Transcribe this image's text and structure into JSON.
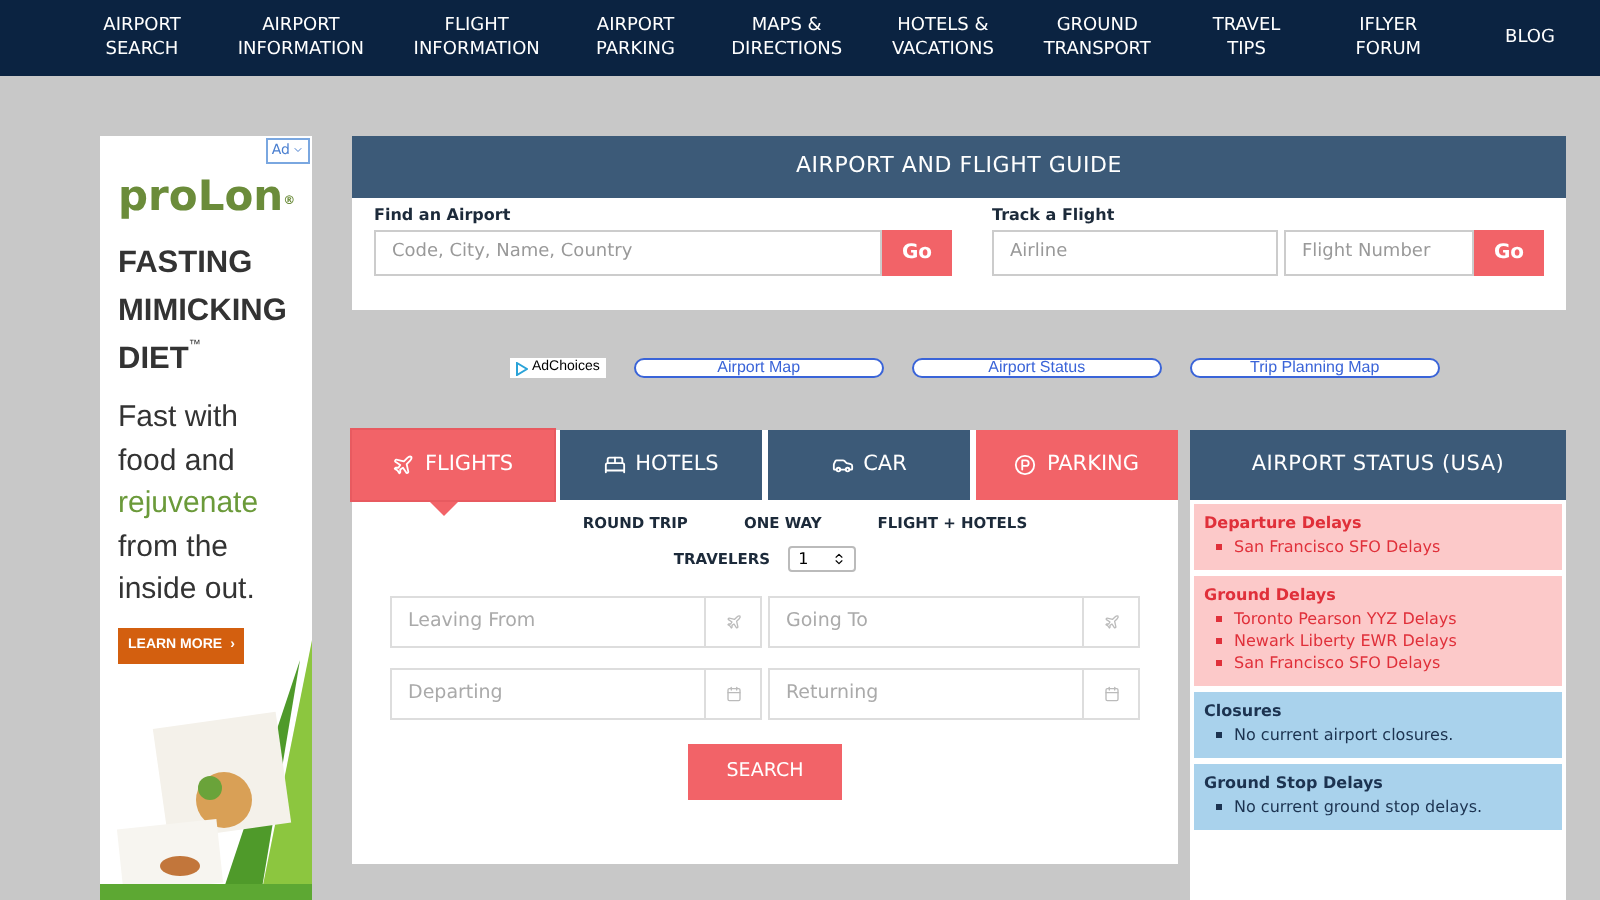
{
  "nav": [
    "AIRPORT SEARCH",
    "AIRPORT INFORMATION",
    "FLIGHT INFORMATION",
    "AIRPORT PARKING",
    "MAPS & DIRECTIONS",
    "HOTELS & VACATIONS",
    "GROUND TRANSPORT",
    "TRAVEL TIPS",
    "IFLYER FORUM",
    "BLOG"
  ],
  "ad": {
    "badge": "Ad",
    "brand": "proLon",
    "trademark": "®",
    "headline": [
      "FASTING",
      "MIMICKING",
      "DIET"
    ],
    "headline_mark": "™",
    "body_lines": [
      {
        "text": "Fast with",
        "highlighted": false
      },
      {
        "text": "food and",
        "highlighted": false
      },
      {
        "text": "rejuvenate",
        "highlighted": true
      },
      {
        "text": "from the",
        "highlighted": false
      },
      {
        "text": "inside out.",
        "highlighted": false
      }
    ],
    "button": "LEARN MORE",
    "button_icon": "›",
    "picture": {
      "kind": "picture"
    }
  },
  "guide": {
    "title": "AIRPORT AND FLIGHT GUIDE",
    "find": {
      "label": "Find an Airport",
      "placeholder": "Code, City, Name, Country",
      "button": "Go"
    },
    "track": {
      "label": "Track a Flight",
      "airline_placeholder": "Airline",
      "flight_placeholder": "Flight Number",
      "button": "Go"
    }
  },
  "links": {
    "adchoices": "AdChoices",
    "items": [
      "Airport Map",
      "Airport Status",
      "Trip Planning Map"
    ]
  },
  "booking": {
    "tabs": [
      {
        "label": "FLIGHTS",
        "color": "#f26368",
        "selected": true
      },
      {
        "label": "HOTELS",
        "color": "#3c5a78",
        "selected": false
      },
      {
        "label": "CAR",
        "color": "#3c5a78",
        "selected": false
      },
      {
        "label": "PARKING",
        "color": "#f26368",
        "selected": false
      }
    ],
    "trip_types": [
      "ROUND TRIP",
      "ONE WAY",
      "FLIGHT + HOTELS"
    ],
    "travelers": {
      "label": "TRAVELERS",
      "value": "1"
    },
    "fields": [
      {
        "placeholder": "Leaving From",
        "kind": "place"
      },
      {
        "placeholder": "Going To",
        "kind": "place"
      },
      {
        "placeholder": "Departing",
        "kind": "date"
      },
      {
        "placeholder": "Returning",
        "kind": "date"
      }
    ],
    "search": "SEARCH"
  },
  "status": {
    "title": "AIRPORT STATUS (USA)",
    "sections": [
      {
        "kind": "alert",
        "heading": "Departure Delays",
        "items": [
          "San Francisco SFO Delays"
        ]
      },
      {
        "kind": "alert",
        "heading": "Ground Delays",
        "items": [
          "Toronto Pearson YYZ Delays",
          "Newark Liberty EWR Delays",
          "San Francisco SFO Delays"
        ]
      },
      {
        "kind": "info",
        "heading": "Closures",
        "items": [
          "No current airport closures."
        ]
      },
      {
        "kind": "info",
        "heading": "Ground Stop Delays",
        "items": [
          "No current ground stop delays."
        ]
      }
    ]
  }
}
